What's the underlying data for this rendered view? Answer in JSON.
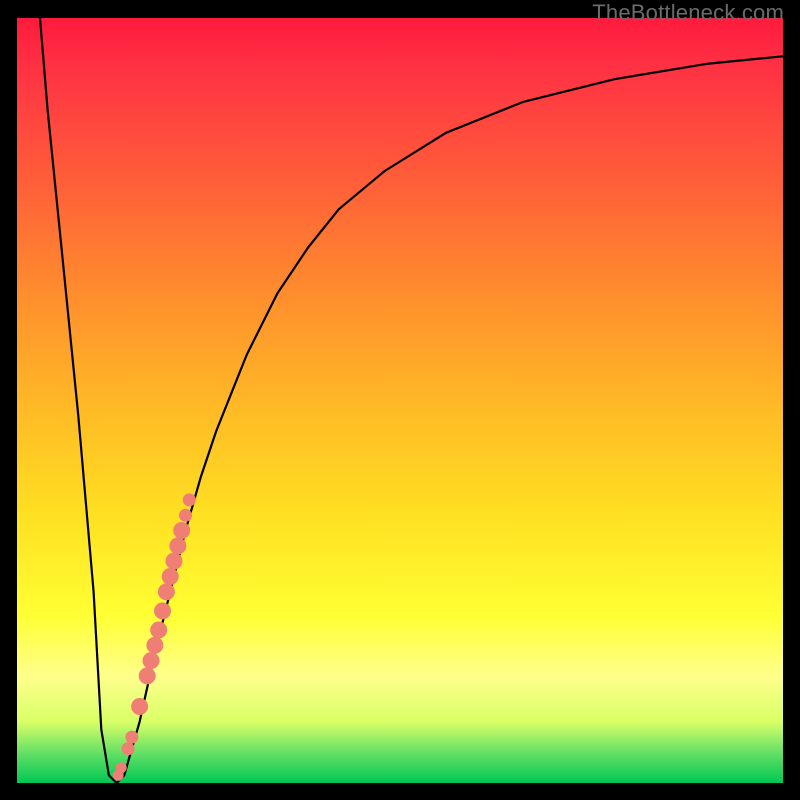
{
  "watermark": "TheBottleneck.com",
  "chart_data": {
    "type": "line",
    "title": "",
    "xlabel": "",
    "ylabel": "",
    "xlim": [
      0,
      100
    ],
    "ylim": [
      0,
      100
    ],
    "series": [
      {
        "name": "curve",
        "x": [
          3,
          4,
          6,
          8,
          10,
          11,
          12,
          13,
          14,
          16,
          18,
          20,
          22,
          24,
          26,
          28,
          30,
          34,
          38,
          42,
          48,
          56,
          66,
          78,
          90,
          100
        ],
        "values": [
          100,
          88,
          68,
          48,
          25,
          7,
          1,
          0,
          1,
          8,
          17,
          25,
          33,
          40,
          46,
          51,
          56,
          64,
          70,
          75,
          80,
          85,
          89,
          92,
          94,
          95
        ]
      }
    ],
    "highlight_points": {
      "comment": "pink/coral dots along the rising branch",
      "x": [
        13.2,
        13.6,
        14.5,
        15.0,
        16.0,
        17.0,
        17.5,
        18.0,
        18.5,
        19.0,
        19.5,
        20.0,
        20.5,
        21.0,
        21.5,
        22.0,
        22.5
      ],
      "values": [
        1.0,
        2.0,
        4.5,
        6.0,
        10.0,
        14.0,
        16.0,
        18.0,
        20.0,
        22.5,
        25.0,
        27.0,
        29.0,
        31.0,
        33.0,
        35.0,
        37.0
      ]
    },
    "colors": {
      "curve": "#000000",
      "dots": "#ef7f74",
      "gradient_top": "#ff1a3c",
      "gradient_bottom": "#00c853"
    }
  }
}
